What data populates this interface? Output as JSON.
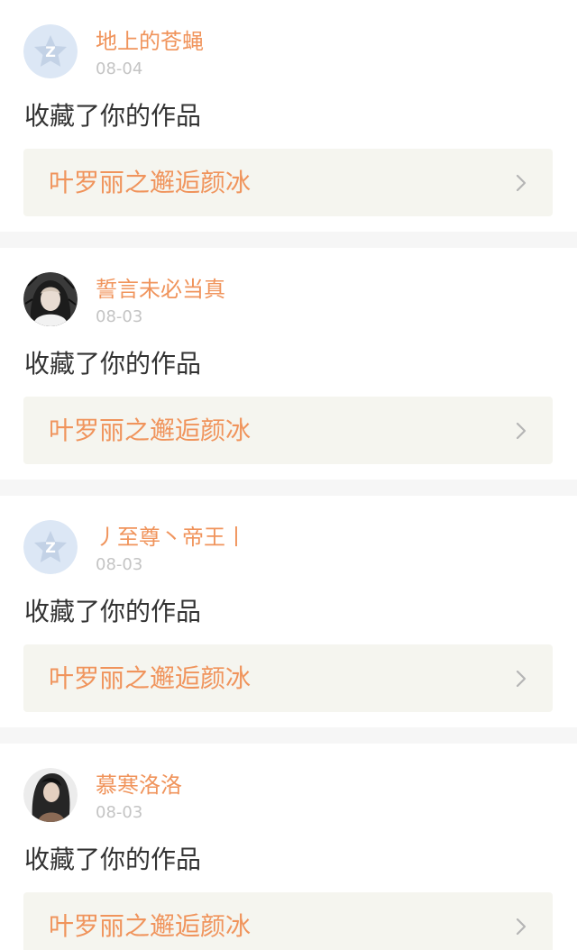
{
  "notifications": [
    {
      "username": "地上的苍蝇",
      "date": "08-04",
      "avatar": "qq-default-avatar",
      "action": "收藏了你的作品",
      "work_title": "叶罗丽之邂逅颜冰",
      "chevron": "chevron-right-icon"
    },
    {
      "username": "誓言未必当真",
      "date": "08-03",
      "avatar": "anime-girl-avatar",
      "action": "收藏了你的作品",
      "work_title": "叶罗丽之邂逅颜冰",
      "chevron": "chevron-right-icon"
    },
    {
      "username": "丿至尊丶帝王丨",
      "date": "08-03",
      "avatar": "qq-default-avatar",
      "action": "收藏了你的作品",
      "work_title": "叶罗丽之邂逅颜冰",
      "chevron": "chevron-right-icon"
    },
    {
      "username": "慕寒洛洛",
      "date": "08-03",
      "avatar": "dark-hair-girl-avatar",
      "action": "收藏了你的作品",
      "work_title": "叶罗丽之邂逅颜冰",
      "chevron": "chevron-right-icon"
    }
  ],
  "colors": {
    "username": "#f0945c",
    "date": "#c4c4c4",
    "action_text": "#333333",
    "work_link_bg": "#f5f5ef",
    "separator": "#f6f6f6",
    "qq_avatar_bg": "#dce7f5",
    "qq_avatar_mark": "#bccbe0"
  }
}
